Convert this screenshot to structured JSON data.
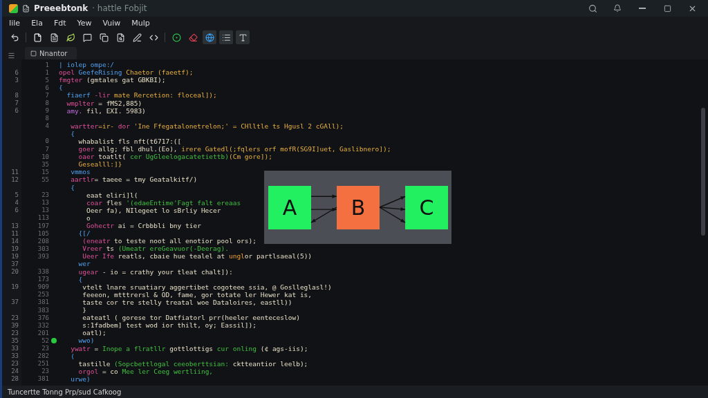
{
  "window": {
    "title": "Preeebtonk",
    "subtitle": "· hattle Fobjit"
  },
  "menu": [
    "Iile",
    "Ela",
    "Fdt",
    "Yew",
    "Vuiw",
    "Mulp"
  ],
  "toolbar": [
    {
      "kind": "undo",
      "selected": false
    },
    {
      "kind": "sep"
    },
    {
      "kind": "file",
      "selected": false
    },
    {
      "kind": "doc",
      "selected": false
    },
    {
      "kind": "leaf",
      "selected": false
    },
    {
      "kind": "chat",
      "selected": false
    },
    {
      "kind": "copy",
      "selected": false
    },
    {
      "kind": "search-doc",
      "selected": false
    },
    {
      "kind": "pen",
      "selected": false
    },
    {
      "kind": "code",
      "selected": false
    },
    {
      "kind": "sep"
    },
    {
      "kind": "green",
      "selected": false
    },
    {
      "kind": "eraser",
      "selected": false
    },
    {
      "kind": "globe",
      "selected": true
    },
    {
      "kind": "list",
      "selected": true
    },
    {
      "kind": "type",
      "selected": true
    }
  ],
  "tab": {
    "label": "Nnantor"
  },
  "code_lines": [
    {
      "num2": "1",
      "tokens": [
        {
          "text": "| iolep ompe:/",
          "kind": "type"
        }
      ]
    },
    {
      "num1": "6",
      "num2": "1",
      "tokens": [
        {
          "text": "opel ",
          "kind": "keyword"
        },
        {
          "text": "GeefeRising ",
          "kind": "type"
        },
        {
          "text": "Chaetor (faeetf);",
          "kind": "string"
        }
      ]
    },
    {
      "num1": "3",
      "num2": "5",
      "tokens": [
        {
          "text": "fmgter ",
          "kind": "keyword"
        },
        {
          "text": "(gmtales gat GBKBI);",
          "kind": "plain"
        }
      ]
    },
    {
      "num2": "6",
      "tokens": [
        {
          "text": "{",
          "kind": "type"
        }
      ]
    },
    {
      "num1": "8",
      "num2": "7",
      "tokens": [
        {
          "text": "  fiaerf ",
          "kind": "type"
        },
        {
          "text": "-lir ",
          "kind": "keyword"
        },
        {
          "text": "mate Rercetion: floceal]);",
          "kind": "string"
        }
      ]
    },
    {
      "num1": "7",
      "num2": "8",
      "tokens": [
        {
          "text": "  wmplter ",
          "kind": "keyword"
        },
        {
          "text": "= fMS2,885)",
          "kind": "plain"
        }
      ]
    },
    {
      "num1": "6",
      "num2": "9",
      "tokens": [
        {
          "text": "  amy. ",
          "kind": "other"
        },
        {
          "text": "fil, EXI. 5983)",
          "kind": "plain"
        }
      ]
    },
    {
      "num2": "8"
    },
    {
      "num2": "4",
      "tokens": [
        {
          "text": "   wartter",
          "kind": "keyword"
        },
        {
          "text": "=ir- ",
          "kind": "string"
        },
        {
          "text": "dor ",
          "kind": "keyword"
        },
        {
          "text": "'Ine Ffegatalonetrelon;' ",
          "kind": "string"
        },
        {
          "text": "= CHlltle ts Hgusl 2 cGAll);",
          "kind": "string"
        }
      ]
    },
    {
      "tokens": [
        {
          "text": "   {",
          "kind": "type"
        }
      ]
    },
    {
      "num2": "0",
      "tokens": [
        {
          "text": "     whabalist fls nft(t6717:([",
          "kind": "plain"
        }
      ]
    },
    {
      "num2": "7",
      "tokens": [
        {
          "text": "     goer ",
          "kind": "keyword"
        },
        {
          "text": "allg; fbl dhul.(Eo), ",
          "kind": "plain"
        },
        {
          "text": "irere Gatedl(;",
          "kind": "string"
        },
        {
          "text": "fqlers orf mofR(SG9I]uet, Gaslibnero]);",
          "kind": "string"
        }
      ]
    },
    {
      "num2": "10",
      "tokens": [
        {
          "text": "     oaer ",
          "kind": "keyword"
        },
        {
          "text": "toatlt( ",
          "kind": "plain"
        },
        {
          "text": "cer UgGleelogacatetiettb)",
          "kind": "green"
        },
        {
          "text": "(Cm gore]);",
          "kind": "string"
        }
      ]
    },
    {
      "num2": "35",
      "tokens": [
        {
          "text": "     Gesealll:]}",
          "kind": "string"
        }
      ]
    },
    {
      "num1": "11",
      "num2": "15",
      "tokens": [
        {
          "text": "   vmmos",
          "kind": "type"
        }
      ]
    },
    {
      "num1": "12",
      "num2": "55",
      "tokens": [
        {
          "text": "   aartlr",
          "kind": "keyword"
        },
        {
          "text": "= taeee = tmy Geatalkitf/)",
          "kind": "plain"
        }
      ]
    },
    {
      "tokens": [
        {
          "text": "   {",
          "kind": "type"
        }
      ]
    },
    {
      "num1": "5",
      "num2": "23",
      "tokens": [
        {
          "text": "       eaat eliri]l(",
          "kind": "plain"
        }
      ]
    },
    {
      "num1": "4",
      "num2": "13",
      "tokens": [
        {
          "text": "       coar ",
          "kind": "keyword"
        },
        {
          "text": "fles ",
          "kind": "plain"
        },
        {
          "text": "'(edaeEntime'Fagt falt ereaas",
          "kind": "green"
        }
      ]
    },
    {
      "num1": "6",
      "num2": "13",
      "tokens": [
        {
          "text": "       Oeer fa), NIlegeet lo sBrliy Hecer",
          "kind": "plain"
        }
      ]
    },
    {
      "num2": "113",
      "tokens": [
        {
          "text": "       o",
          "kind": "plain"
        }
      ]
    },
    {
      "num1": "13",
      "num2": "197",
      "tokens": [
        {
          "text": "       Gohectr ",
          "kind": "keyword"
        },
        {
          "text": "ai = Crbbbli bny tier",
          "kind": "plain"
        }
      ]
    },
    {
      "num1": "11",
      "num2": "105",
      "tokens": [
        {
          "text": "     {[/",
          "kind": "type"
        }
      ]
    },
    {
      "num1": "14",
      "num2": "208",
      "tokens": [
        {
          "text": "      (eneatr ",
          "kind": "keyword"
        },
        {
          "text": "to teste noot all enotior pool ors);",
          "kind": "plain"
        }
      ]
    },
    {
      "num1": "19",
      "num2": "303",
      "tokens": [
        {
          "text": "      Vreer ",
          "kind": "keyword"
        },
        {
          "text": "ts ",
          "kind": "plain"
        },
        {
          "text": "(Umeatr ereGeavuor(-Deerag).",
          "kind": "green"
        }
      ]
    },
    {
      "num1": "19",
      "num2": "393",
      "tokens": [
        {
          "text": "      Ueer Ife ",
          "kind": "keyword"
        },
        {
          "text": "reatls, cbaie hue tealel at ",
          "kind": "plain"
        },
        {
          "text": "ungl",
          "kind": "number"
        },
        {
          "text": "or partlsaeal(5))",
          "kind": "plain"
        }
      ]
    },
    {
      "num1": "37",
      "tokens": [
        {
          "text": "     wer",
          "kind": "type"
        }
      ]
    },
    {
      "num1": "20",
      "num2": "338",
      "tokens": [
        {
          "text": "     ugear ",
          "kind": "keyword"
        },
        {
          "text": "- io = crathy your tleat chalt]):",
          "kind": "plain"
        }
      ]
    },
    {
      "num2": "173",
      "tokens": [
        {
          "text": "     {",
          "kind": "type"
        }
      ]
    },
    {
      "num1": "19",
      "num2": "909",
      "tokens": [
        {
          "text": "      vtelt lnare sruatiary aggertibet cogoteee ssia, @ Goslleglasl!)",
          "kind": "plain"
        }
      ]
    },
    {
      "num2": "253",
      "tokens": [
        {
          "text": "      feeeon, mtttrersl & OD, fame, gor totate ler Hewer kat is,",
          "kind": "plain"
        }
      ]
    },
    {
      "num1": "37",
      "num2": "381",
      "tokens": [
        {
          "text": "      taste cor tre stelly treatal woe Dataloires, eastll))",
          "kind": "plain"
        }
      ]
    },
    {
      "num2": "383",
      "tokens": [
        {
          "text": "      }",
          "kind": "plain"
        }
      ]
    },
    {
      "num1": "23",
      "num2": "376",
      "tokens": [
        {
          "text": "      eateatl ( gorese tor Datfiatorl prr(heeler eenteceslow)",
          "kind": "plain"
        }
      ]
    },
    {
      "num1": "39",
      "num2": "332",
      "tokens": [
        {
          "text": "      s:1fadbem] test wod ior thilt, oy; Eassil]);",
          "kind": "plain"
        }
      ]
    },
    {
      "num1": "23",
      "num2": "201",
      "tokens": [
        {
          "text": "      oatl);",
          "kind": "plain"
        }
      ]
    },
    {
      "num1": "35",
      "num2": "52",
      "breakpoint": true,
      "tokens": [
        {
          "text": "     wwo)",
          "kind": "type"
        }
      ]
    },
    {
      "num1": "33",
      "num2": "23",
      "tokens": [
        {
          "text": "   ywatr ",
          "kind": "keyword"
        },
        {
          "text": "= ",
          "kind": "plain"
        },
        {
          "text": "Inope a flratllr ",
          "kind": "green"
        },
        {
          "text": "gottlottigs ",
          "kind": "plain"
        },
        {
          "text": "cur onling ",
          "kind": "green"
        },
        {
          "text": "(¢ ags-iis);",
          "kind": "plain"
        }
      ]
    },
    {
      "num1": "33",
      "num2": "282",
      "tokens": [
        {
          "text": "   (",
          "kind": "type"
        }
      ]
    },
    {
      "num1": "23",
      "num2": "251",
      "tokens": [
        {
          "text": "     tastille ",
          "kind": "plain"
        },
        {
          "text": "(Sopcbettlogal ceeoberttsian: ",
          "kind": "green"
        },
        {
          "text": "cktteantior leelb);",
          "kind": "plain"
        }
      ]
    },
    {
      "num1": "24",
      "num2": "23",
      "tokens": [
        {
          "text": "     orgol ",
          "kind": "keyword"
        },
        {
          "text": "= co ",
          "kind": "plain"
        },
        {
          "text": "Mee ler Ceeg wertliing,",
          "kind": "green"
        }
      ]
    },
    {
      "num1": "28",
      "num2": "381",
      "tokens": [
        {
          "text": "   urwe)",
          "kind": "type"
        }
      ]
    }
  ],
  "diagram": {
    "nodes": [
      {
        "label": "A",
        "color": "#22f060"
      },
      {
        "label": "B",
        "color": "#f47040"
      },
      {
        "label": "C",
        "color": "#22f060"
      }
    ],
    "gaps": [
      {
        "kind": "parallel",
        "arrows": [
          {
            "kind": "right"
          },
          {
            "kind": "right"
          },
          {
            "kind": "left"
          }
        ]
      },
      {
        "kind": "fan",
        "arrows": [
          {
            "kind": "right"
          },
          {
            "kind": "right"
          },
          {
            "kind": "right"
          }
        ]
      }
    ]
  },
  "status_bar": {
    "text": "Tuncertte Tonng Prp/sud Cafkoog"
  }
}
